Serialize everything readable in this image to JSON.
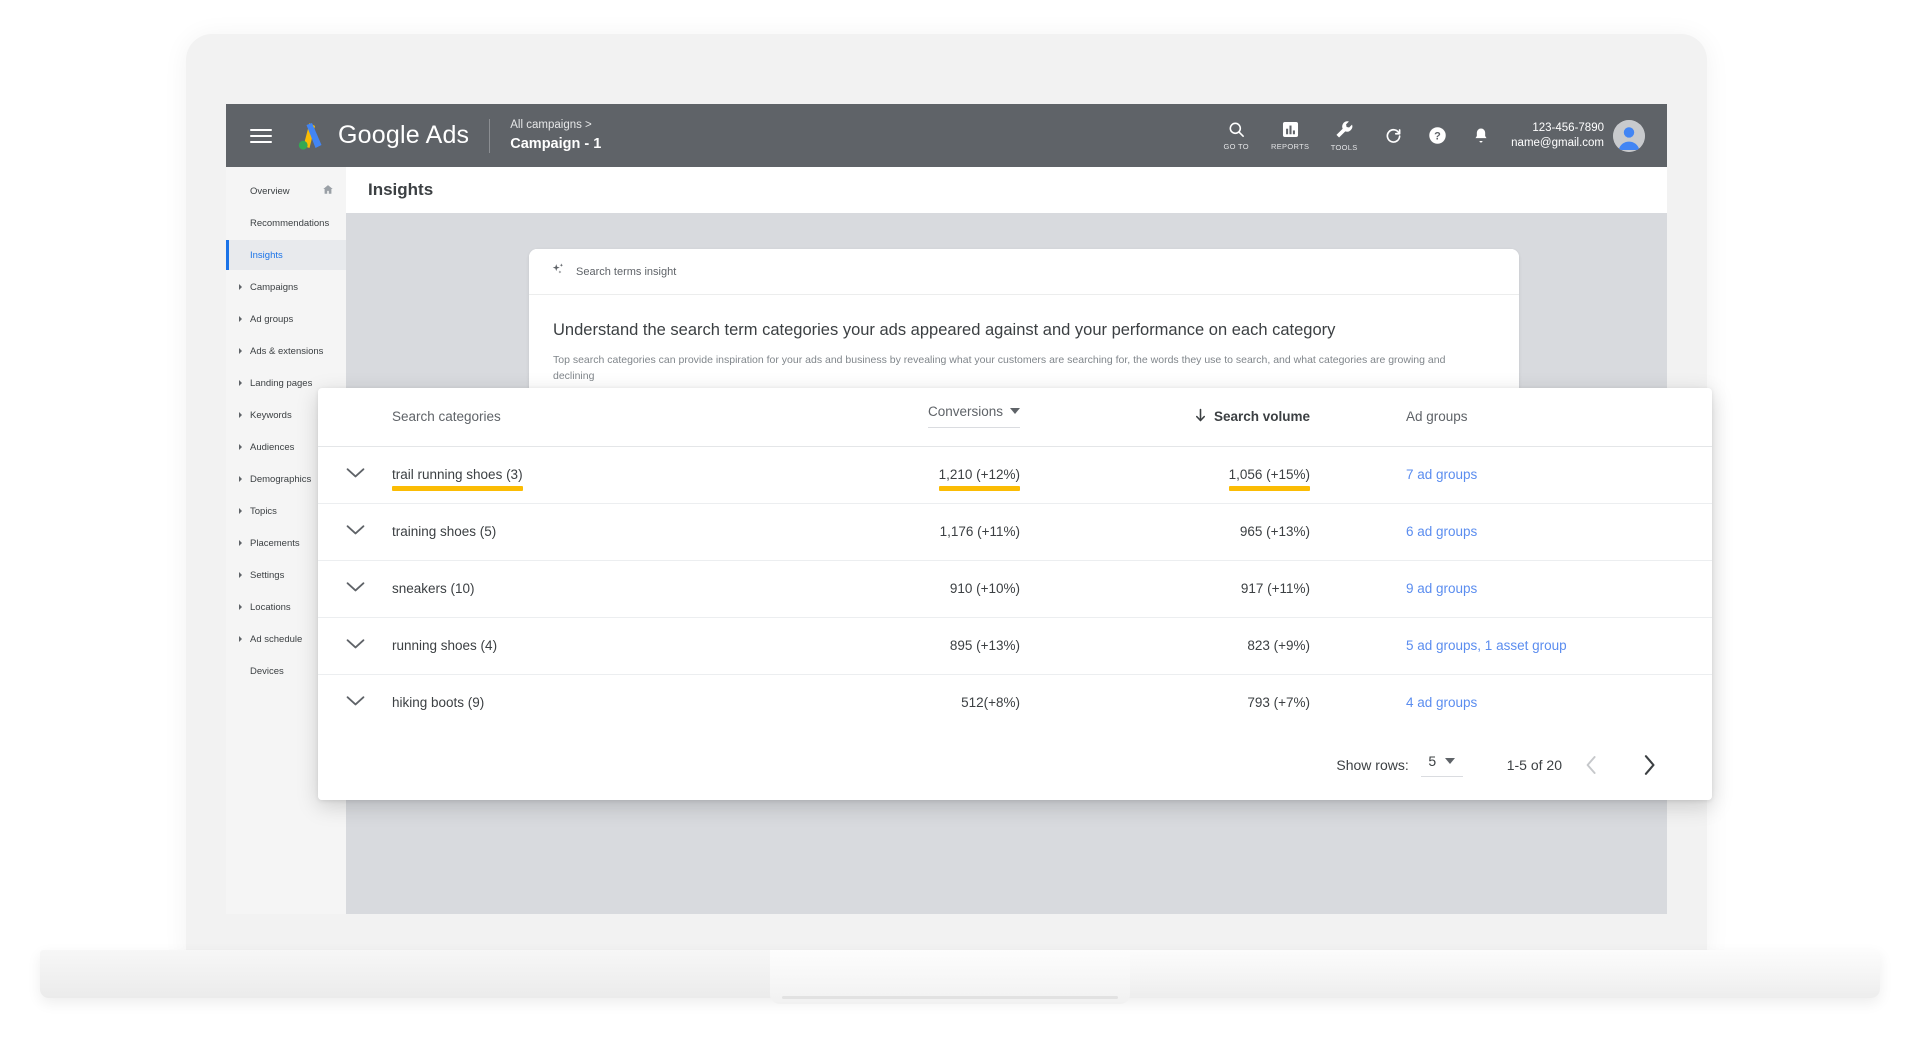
{
  "topbar": {
    "menu_icon": "hamburger-menu-icon",
    "logo_icon": "google-ads-logo-icon",
    "brand": "Google Ads",
    "breadcrumb_parent": "All campaigns >",
    "breadcrumb_current": "Campaign - 1",
    "actions": [
      {
        "icon": "search-icon",
        "label": "GO TO"
      },
      {
        "icon": "reports-icon",
        "label": "REPORTS"
      },
      {
        "icon": "tools-icon",
        "label": "TOOLS"
      }
    ],
    "plain_actions": [
      {
        "icon": "refresh-icon"
      },
      {
        "icon": "help-icon"
      },
      {
        "icon": "notifications-bell-icon"
      }
    ],
    "account_id": "123-456-7890",
    "account_email": "name@gmail.com",
    "avatar": "user-avatar-icon"
  },
  "sidebar": {
    "items": [
      {
        "label": "Overview",
        "expandable": false,
        "active": false,
        "trailing_icon": "home-icon"
      },
      {
        "label": "Recommendations",
        "expandable": false,
        "active": false
      },
      {
        "label": "Insights",
        "expandable": false,
        "active": true
      },
      {
        "label": "Campaigns",
        "expandable": true,
        "active": false
      },
      {
        "label": "Ad groups",
        "expandable": true,
        "active": false
      },
      {
        "label": "Ads & extensions",
        "expandable": true,
        "active": false
      },
      {
        "label": "Landing pages",
        "expandable": true,
        "active": false
      },
      {
        "label": "Keywords",
        "expandable": true,
        "active": false
      },
      {
        "label": "Audiences",
        "expandable": true,
        "active": false
      },
      {
        "label": "Demographics",
        "expandable": true,
        "active": false
      },
      {
        "label": "Topics",
        "expandable": true,
        "active": false
      },
      {
        "label": "Placements",
        "expandable": true,
        "active": false
      },
      {
        "label": "Settings",
        "expandable": true,
        "active": false
      },
      {
        "label": "Locations",
        "expandable": true,
        "active": false
      },
      {
        "label": "Ad schedule",
        "expandable": true,
        "active": false
      },
      {
        "label": "Devices",
        "expandable": false,
        "active": false
      }
    ]
  },
  "page": {
    "title": "Insights"
  },
  "insight_card": {
    "badge_icon": "sparkle-insight-icon",
    "badge_label": "Search terms insight",
    "title": "Understand the search term categories your ads appeared against and your performance on each category",
    "description": "Top search categories can provide inspiration for your ads and business by revealing what your customers are searching for, the words they use to search, and what categories are growing and declining"
  },
  "table": {
    "columns": {
      "category": "Search categories",
      "conversions": "Conversions",
      "search_volume": "Search volume",
      "ad_groups": "Ad groups"
    },
    "sort": {
      "column": "search_volume",
      "direction_icon": "arrow-down-icon"
    },
    "conversions_sort_icon": "caret-down-icon",
    "row_expand_icon": "chevron-down-icon",
    "highlight_color": "#fbbc04",
    "link_color": "#5b8def",
    "rows": [
      {
        "category": "trail running shoes (3)",
        "conversions": "1,210 (+12%)",
        "search_volume": "1,056 (+15%)",
        "ad_groups": "7 ad groups",
        "highlighted": true
      },
      {
        "category": "training shoes (5)",
        "conversions": "1,176 (+11%)",
        "search_volume": "965 (+13%)",
        "ad_groups": "6 ad groups",
        "highlighted": false
      },
      {
        "category": "sneakers (10)",
        "conversions": "910 (+10%)",
        "search_volume": "917 (+11%)",
        "ad_groups": "9 ad groups",
        "highlighted": false
      },
      {
        "category": "running shoes (4)",
        "conversions": "895 (+13%)",
        "search_volume": "823 (+9%)",
        "ad_groups": "5 ad groups, 1 asset group",
        "highlighted": false
      },
      {
        "category": "hiking boots (9)",
        "conversions": "512(+8%)",
        "search_volume": "793 (+7%)",
        "ad_groups": "4 ad groups",
        "highlighted": false
      }
    ]
  },
  "pagination": {
    "show_rows_label": "Show rows:",
    "rows_per_page": "5",
    "rows_caret_icon": "caret-down-icon",
    "range": "1-5 of 20",
    "prev_icon": "chevron-left-icon",
    "next_icon": "chevron-right-icon"
  }
}
